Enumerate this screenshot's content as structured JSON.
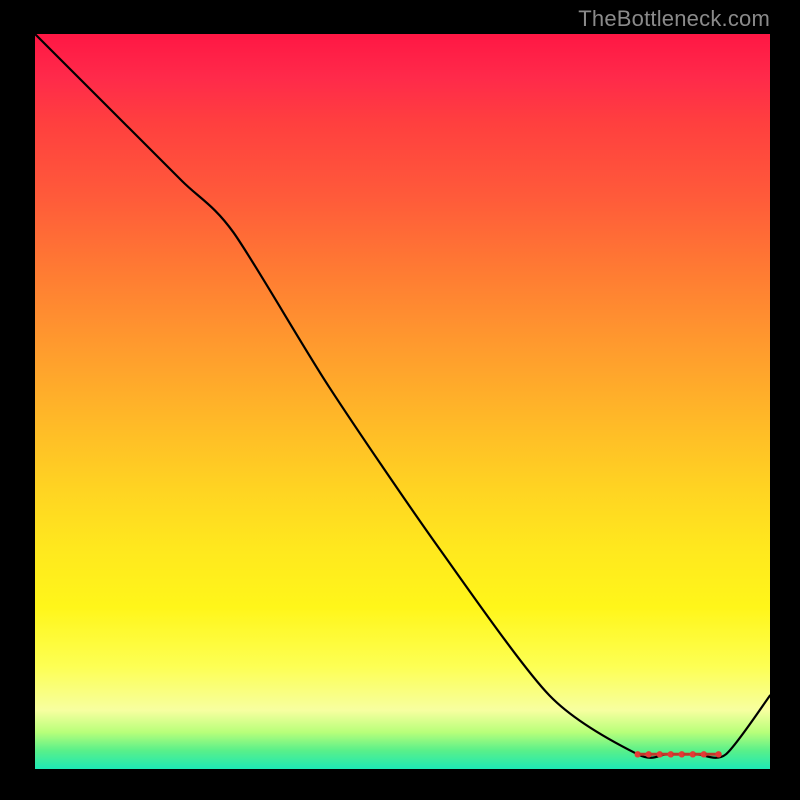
{
  "watermark": "TheBottleneck.com",
  "chart_data": {
    "type": "line",
    "title": "",
    "xlabel": "",
    "ylabel": "",
    "xlim": [
      0,
      100
    ],
    "ylim": [
      0,
      100
    ],
    "grid": false,
    "legend": false,
    "series": [
      {
        "name": "curve",
        "x": [
          0,
          10,
          20,
          27,
          40,
          55,
          70,
          82,
          86,
          90,
          94,
          100
        ],
        "y": [
          100,
          90,
          80,
          73,
          52,
          30,
          10,
          2,
          2,
          2,
          2,
          10
        ]
      }
    ],
    "markers": {
      "style": "dash-ring",
      "color": "#e53935",
      "x": [
        82,
        83.5,
        85,
        86.5,
        88,
        89.5,
        91,
        93
      ],
      "y": [
        2,
        2,
        2,
        2,
        2,
        2,
        2,
        2
      ]
    },
    "background_gradient": [
      {
        "stop": 0.0,
        "color": "#ff1744"
      },
      {
        "stop": 0.5,
        "color": "#ffb728"
      },
      {
        "stop": 0.8,
        "color": "#fff61a"
      },
      {
        "stop": 0.95,
        "color": "#b8ff7a"
      },
      {
        "stop": 1.0,
        "color": "#1de9b6"
      }
    ]
  }
}
